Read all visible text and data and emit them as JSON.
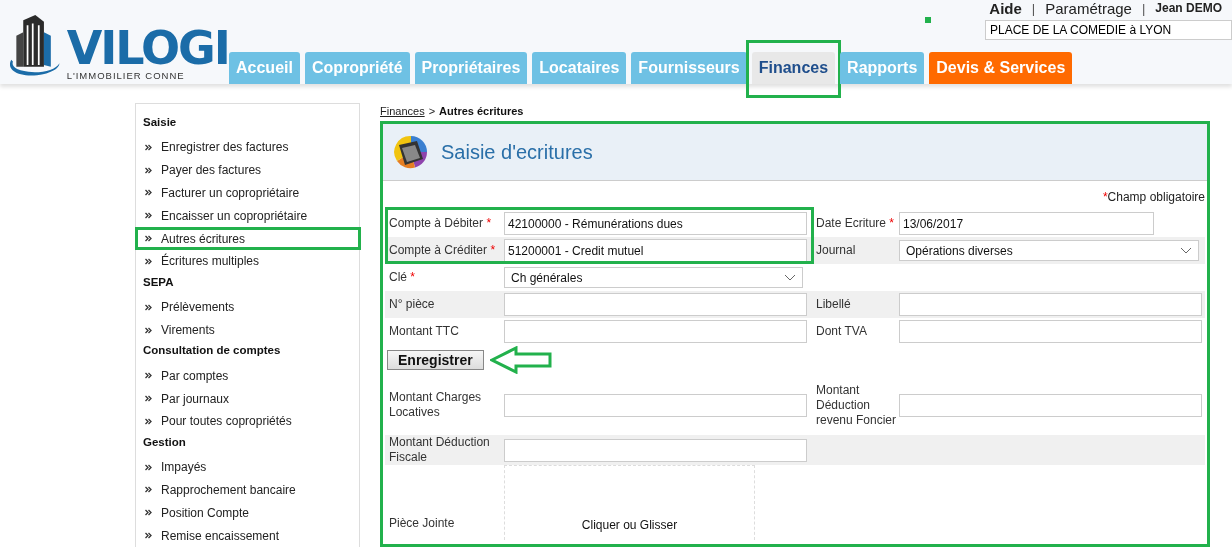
{
  "header": {
    "logo": {
      "name": "VILOGI",
      "tagline": "L'IMMOBILIER CONNE"
    },
    "link_separator": "|",
    "top_links": [
      {
        "label": "Aide",
        "bold": true
      },
      {
        "label": "Paramétrage",
        "bold": false
      },
      {
        "label": "Jean DEMO",
        "bold": true
      }
    ],
    "address": {
      "value": "PLACE DE LA COMEDIE à LYON"
    },
    "tabs": [
      {
        "label": "Accueil",
        "kind": "standard",
        "selected": false,
        "highlighted": false
      },
      {
        "label": "Copropriété",
        "kind": "standard",
        "selected": false,
        "highlighted": false
      },
      {
        "label": "Propriétaires",
        "kind": "standard",
        "selected": false,
        "highlighted": false
      },
      {
        "label": "Locataires",
        "kind": "standard",
        "selected": false,
        "highlighted": false
      },
      {
        "label": "Fournisseurs",
        "kind": "standard",
        "selected": false,
        "highlighted": false
      },
      {
        "label": "Finances",
        "kind": "standard",
        "selected": true,
        "highlighted": true
      },
      {
        "label": "Rapports",
        "kind": "standard",
        "selected": false,
        "highlighted": false
      },
      {
        "label": "Devis & Services",
        "kind": "promo",
        "selected": false,
        "highlighted": false
      }
    ]
  },
  "sidebar": {
    "sections": [
      {
        "title": "Saisie",
        "items": [
          {
            "label": "Enregistrer des factures",
            "highlighted": false
          },
          {
            "label": "Payer des factures",
            "highlighted": false
          },
          {
            "label": "Facturer un copropriétaire",
            "highlighted": false
          },
          {
            "label": "Encaisser un copropriétaire",
            "highlighted": false
          },
          {
            "label": "Autres écritures",
            "highlighted": true
          },
          {
            "label": "Écritures multiples",
            "highlighted": false
          }
        ]
      },
      {
        "title": "SEPA",
        "items": [
          {
            "label": "Prélèvements",
            "highlighted": false
          },
          {
            "label": "Virements",
            "highlighted": false
          }
        ]
      },
      {
        "title": "Consultation de comptes",
        "items": [
          {
            "label": "Par comptes",
            "highlighted": false
          },
          {
            "label": "Par journaux",
            "highlighted": false
          },
          {
            "label": "Pour toutes copropriétés",
            "highlighted": false
          }
        ]
      },
      {
        "title": "Gestion",
        "items": [
          {
            "label": "Impayés",
            "highlighted": false
          },
          {
            "label": "Rapprochement bancaire",
            "highlighted": false
          },
          {
            "label": "Position Compte",
            "highlighted": false
          },
          {
            "label": "Remise encaissement",
            "highlighted": false
          }
        ]
      }
    ]
  },
  "breadcrumb": {
    "link": "Finances",
    "separator": ">",
    "current": "Autres écritures"
  },
  "panel": {
    "title": "Saisie d'ecritures",
    "highlighted": true,
    "required_note": {
      "mark": "*",
      "text": "Champ obligatoire"
    },
    "rows": [
      {
        "highlighted": true,
        "left": {
          "label": "Compte à Débiter",
          "required": true,
          "kind": "text",
          "value": "42100000 - Rémunérations dues"
        },
        "right": {
          "label": "Date Ecriture",
          "required": true,
          "kind": "short",
          "value": "13/06/2017"
        }
      },
      {
        "highlighted": true,
        "left": {
          "label": "Compte à Créditer",
          "required": true,
          "kind": "text",
          "value": "51200001 - Credit mutuel"
        },
        "right": {
          "label": "Journal",
          "required": false,
          "kind": "select",
          "value": "Opérations diverses"
        }
      },
      {
        "highlighted": false,
        "left": {
          "label": "Clé",
          "required": true,
          "kind": "select",
          "value": "Ch générales"
        }
      },
      {
        "highlighted": false,
        "left": {
          "label": "N° pièce",
          "required": false,
          "kind": "text"
        },
        "right": {
          "label": "Libellé",
          "required": false,
          "kind": "text"
        }
      },
      {
        "highlighted": false,
        "left": {
          "label": "Montant TTC",
          "required": false,
          "kind": "text"
        },
        "right": {
          "label": "Dont TVA",
          "required": false,
          "kind": "text"
        }
      },
      {
        "highlighted": false,
        "kind": "button",
        "button": {
          "label": "Enregistrer",
          "annotated": true
        }
      },
      {
        "highlighted": false,
        "left": {
          "label": "Montant Charges Locatives",
          "required": false,
          "kind": "text"
        },
        "right": {
          "label": "Montant Déduction revenu Foncier",
          "required": false,
          "kind": "text"
        }
      },
      {
        "highlighted": false,
        "left": {
          "label": "Montant Déduction Fiscale",
          "required": false,
          "kind": "text"
        }
      },
      {
        "highlighted": false,
        "left": {
          "label": "Pièce Jointe",
          "required": false,
          "kind": "dropzone",
          "value": "Cliquer ou Glisser"
        }
      }
    ]
  }
}
